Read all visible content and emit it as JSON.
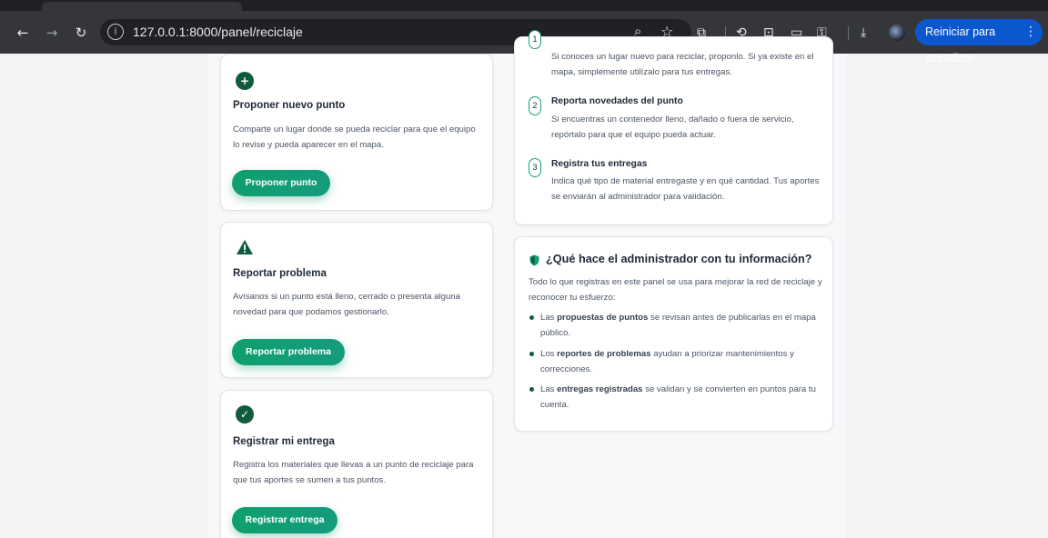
{
  "browser": {
    "url": "127.0.0.1:8000/panel/reciclaje",
    "update_label": "Reiniciar para actualizar"
  },
  "actions": [
    {
      "icon": "plus-circle-icon",
      "title": "Proponer nuevo punto",
      "description": "Comparte un lugar donde se pueda reciclar para que el equipo lo revise y pueda aparecer en el mapa.",
      "button": "Proponer punto"
    },
    {
      "icon": "warning-triangle-icon",
      "title": "Reportar problema",
      "description": "Avísanos si un punto está lleno, cerrado o presenta alguna novedad para que podamos gestionarlo.",
      "button": "Reportar problema"
    },
    {
      "icon": "check-circle-icon",
      "title": "Registrar mi entrega",
      "description": "Registra los materiales que llevas a un punto de reciclaje para que tus aportes se sumen a tus puntos.",
      "button": "Registrar entrega"
    }
  ],
  "steps": [
    {
      "number": "1",
      "title": "",
      "description": "Si conoces un lugar nuevo para reciclar, proponlo. Si ya existe en el mapa, simplemente utilízalo para tus entregas."
    },
    {
      "number": "2",
      "title": "Reporta novedades del punto",
      "description": "Si encuentras un contenedor lleno, dañado o fuera de servicio, repórtalo para que el equipo pueda actuar."
    },
    {
      "number": "3",
      "title": "Registra tus entregas",
      "description": "Indica qué tipo de material entregaste y en qué cantidad. Tus aportes se enviarán al administrador para validación."
    }
  ],
  "admin": {
    "title": "¿Qué hace el administrador con tu información?",
    "intro": "Todo lo que registras en este panel se usa para mejorar la red de reciclaje y reconocer tu esfuerzo:",
    "bullets": [
      {
        "pre": "Las ",
        "bold": "propuestas de puntos",
        "post": " se revisan antes de publicarlas en el mapa público."
      },
      {
        "pre": "Los ",
        "bold": "reportes de problemas",
        "post": " ayudan a priorizar mantenimientos y correcciones."
      },
      {
        "pre": "Las ",
        "bold": "entregas registradas",
        "post": " se validan y se convierten en puntos para tu cuenta."
      }
    ]
  },
  "colors": {
    "accent": "#0f9f6e",
    "icon_dark": "#0f5b3e",
    "browser_blue": "#0b57d0"
  }
}
